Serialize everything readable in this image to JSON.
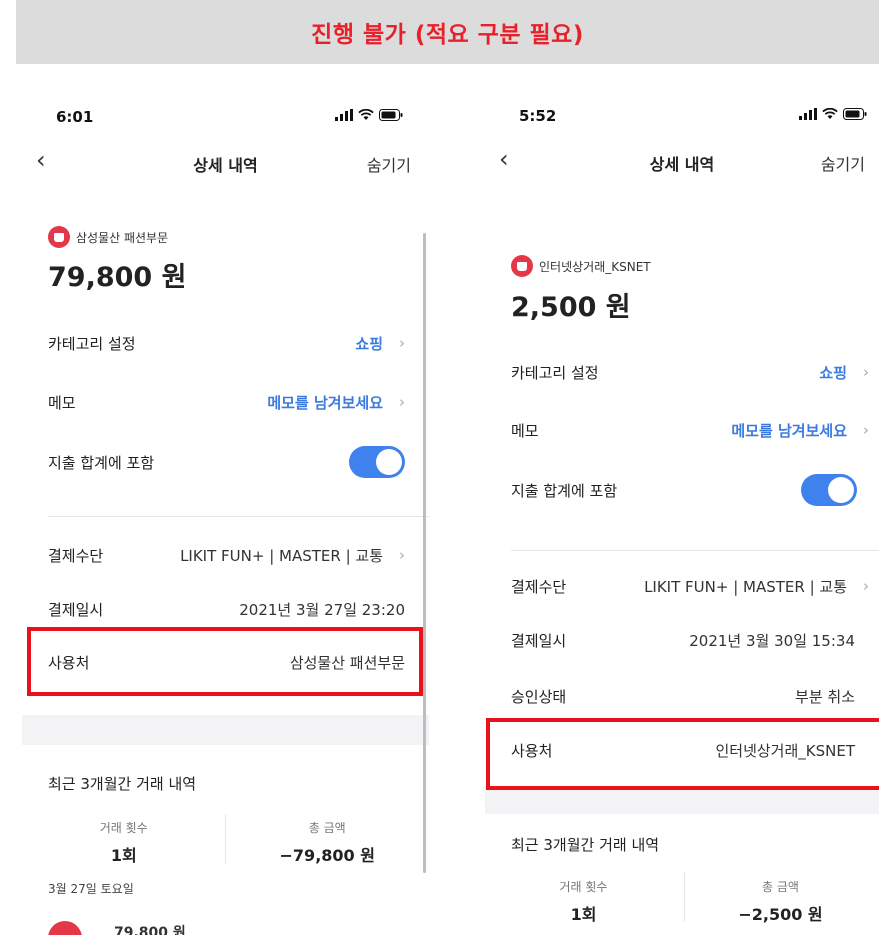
{
  "banner": {
    "text": "진행 불가 (적요 구분 필요)"
  },
  "left": {
    "time": "6:01",
    "nav_title": "상세 내역",
    "nav_hide": "숨기기",
    "merchant": "삼성물산 패션부문",
    "amount": "79,800 원",
    "category_label": "카테고리 설정",
    "category_value": "쇼핑",
    "memo_label": "메모",
    "memo_value": "메모를 남겨보세요",
    "include_label": "지출 합계에 포함",
    "include_on": true,
    "payment_label": "결제수단",
    "payment_value": "LIKIT FUN+ | MASTER | 교통",
    "date_label": "결제일시",
    "date_value": "2021년 3월 27일 23:20",
    "place_label": "사용처",
    "place_value": "삼성물산 패션부문",
    "recent_title": "최근 3개월간 거래 내역",
    "count_label": "거래 횟수",
    "count_value": "1회",
    "total_label": "총 금액",
    "total_value": "−79,800 원",
    "day_label": "3월 27일 토요일",
    "peek_amount": "79,800 원"
  },
  "right": {
    "time": "5:52",
    "nav_title": "상세 내역",
    "nav_hide": "숨기기",
    "merchant": "인터넷상거래_KSNET",
    "amount": "2,500 원",
    "category_label": "카테고리 설정",
    "category_value": "쇼핑",
    "memo_label": "메모",
    "memo_value": "메모를 남겨보세요",
    "include_label": "지출 합계에 포함",
    "include_on": true,
    "payment_label": "결제수단",
    "payment_value": "LIKIT FUN+ | MASTER | 교통",
    "date_label": "결제일시",
    "date_value": "2021년 3월 30일 15:34",
    "approval_label": "승인상태",
    "approval_value": "부분 취소",
    "place_label": "사용처",
    "place_value": "인터넷상거래_KSNET",
    "recent_title": "최근 3개월간 거래 내역",
    "count_label": "거래 횟수",
    "count_value": "1회",
    "total_label": "총 금액",
    "total_value": "−2,500 원"
  },
  "chevron": "›",
  "back_glyph": "‹",
  "colors": {
    "accent": "#3b7bdf",
    "toggle": "#3f82ee",
    "highlight": "#e8121a",
    "banner_text": "#e8202a"
  }
}
